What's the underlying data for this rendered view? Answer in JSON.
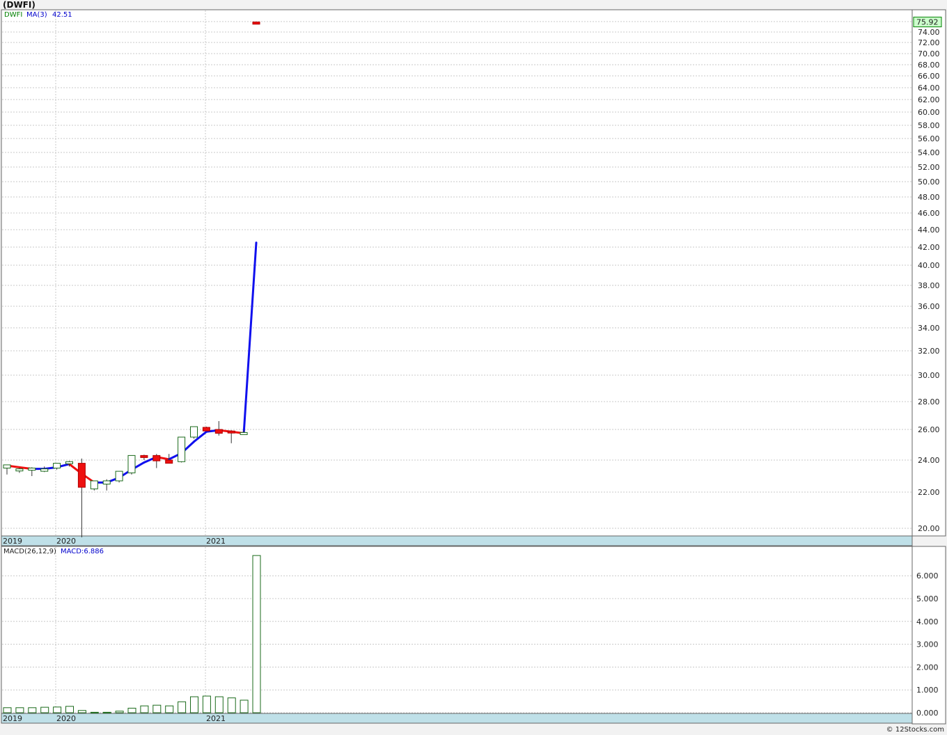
{
  "header": {
    "title": "(DWFI)"
  },
  "footer": {
    "copyright": "© 12Stocks.com"
  },
  "price_panel": {
    "symbol_label": "DWFI",
    "ma_label": "MA(3)",
    "ma_value": "42.51",
    "last_price_tag": "75.92",
    "colors": {
      "symbol": "#008000",
      "ma": "#0000cc",
      "tag_bg": "#ccffcc",
      "tag_border": "#008000"
    }
  },
  "macd_panel": {
    "label": "MACD(26,12,9)",
    "value_label": "MACD:6.886",
    "colors": {
      "label": "#222222",
      "value": "#0000cc"
    }
  },
  "chart_data": [
    {
      "type": "candlestick",
      "title": "(DWFI)",
      "ylim": [
        19.5,
        76
      ],
      "y_ticks": [
        "20.00",
        "22.00",
        "24.00",
        "26.00",
        "28.00",
        "30.00",
        "32.00",
        "34.00",
        "36.00",
        "38.00",
        "40.00",
        "42.00",
        "44.00",
        "46.00",
        "48.00",
        "50.00",
        "52.00",
        "54.00",
        "56.00",
        "58.00",
        "60.00",
        "62.00",
        "64.00",
        "66.00",
        "68.00",
        "70.00",
        "72.00",
        "74.00",
        "76.00"
      ],
      "y_tick_values": [
        20,
        22,
        24,
        26,
        28,
        30,
        32,
        34,
        36,
        38,
        40,
        42,
        44,
        46,
        48,
        50,
        52,
        54,
        56,
        58,
        60,
        62,
        64,
        66,
        68,
        70,
        72,
        74,
        76
      ],
      "x_labels": [
        {
          "label": "2019",
          "index": 0
        },
        {
          "label": "2020",
          "index": 4
        },
        {
          "label": "2021",
          "index": 16
        }
      ],
      "candles": [
        {
          "o": 23.5,
          "h": 23.7,
          "l": 23.1,
          "c": 23.7
        },
        {
          "o": 23.35,
          "h": 23.5,
          "l": 23.2,
          "c": 23.45
        },
        {
          "o": 23.5,
          "h": 23.55,
          "l": 23.0,
          "c": 23.5
        },
        {
          "o": 23.3,
          "h": 23.6,
          "l": 23.25,
          "c": 23.45
        },
        {
          "o": 23.5,
          "h": 23.8,
          "l": 23.4,
          "c": 23.8
        },
        {
          "o": 23.8,
          "h": 23.95,
          "l": 23.6,
          "c": 23.9
        },
        {
          "o": 23.8,
          "h": 24.1,
          "l": 19.5,
          "c": 22.3
        },
        {
          "o": 22.2,
          "h": 22.7,
          "l": 22.1,
          "c": 22.7
        },
        {
          "o": 22.5,
          "h": 22.8,
          "l": 22.1,
          "c": 22.7
        },
        {
          "o": 22.7,
          "h": 23.3,
          "l": 22.6,
          "c": 23.3
        },
        {
          "o": 23.2,
          "h": 24.3,
          "l": 23.1,
          "c": 24.3
        },
        {
          "o": 24.3,
          "h": 24.35,
          "l": 24.0,
          "c": 24.2
        },
        {
          "o": 24.3,
          "h": 24.4,
          "l": 23.5,
          "c": 23.95
        },
        {
          "o": 24.0,
          "h": 24.4,
          "l": 23.8,
          "c": 23.8
        },
        {
          "o": 23.9,
          "h": 25.5,
          "l": 23.85,
          "c": 25.5
        },
        {
          "o": 25.5,
          "h": 26.2,
          "l": 25.4,
          "c": 26.2
        },
        {
          "o": 26.15,
          "h": 26.2,
          "l": 25.9,
          "c": 25.9
        },
        {
          "o": 26.0,
          "h": 26.6,
          "l": 25.6,
          "c": 25.75
        },
        {
          "o": 25.9,
          "h": 25.95,
          "l": 25.1,
          "c": 25.8
        },
        {
          "o": 25.8,
          "h": 25.95,
          "l": 25.7,
          "c": 25.8
        },
        {
          "o": 75.92,
          "h": 75.92,
          "l": 75.5,
          "c": 75.5
        }
      ],
      "ma_series": {
        "name": "MA(3)",
        "values": [
          23.65,
          23.55,
          23.45,
          23.45,
          23.55,
          23.75,
          23.15,
          22.6,
          22.6,
          22.9,
          23.4,
          23.85,
          24.2,
          24.05,
          24.45,
          25.2,
          25.85,
          25.95,
          25.85,
          25.75,
          42.51
        ]
      }
    },
    {
      "type": "bar",
      "title": "MACD(26,12,9)",
      "ylim": [
        -0.05,
        7.0
      ],
      "y_ticks": [
        "0.000",
        "1.000",
        "2.000",
        "3.000",
        "4.000",
        "5.000",
        "6.000"
      ],
      "y_tick_values": [
        0,
        1,
        2,
        3,
        4,
        5,
        6
      ],
      "x_labels": [
        {
          "label": "2019",
          "index": 0
        },
        {
          "label": "2020",
          "index": 4
        },
        {
          "label": "2021",
          "index": 16
        }
      ],
      "values": [
        0.22,
        0.22,
        0.22,
        0.24,
        0.25,
        0.28,
        0.1,
        0.02,
        0.02,
        0.07,
        0.2,
        0.3,
        0.33,
        0.3,
        0.48,
        0.7,
        0.73,
        0.7,
        0.65,
        0.55,
        6.886
      ]
    }
  ]
}
